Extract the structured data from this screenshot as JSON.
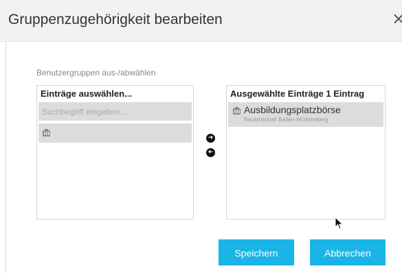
{
  "dialog": {
    "title": "Gruppenzugehörigkeit bearbeiten",
    "close_glyph": "×",
    "icons": {
      "close": "close-icon",
      "group": "group-building-icon",
      "move_right": "arrow-right-circle-icon",
      "move_left": "arrow-left-circle-icon",
      "cursor": "mouse-pointer-icon"
    }
  },
  "section": {
    "label": "Benutzergruppen aus-/abwählen"
  },
  "left_panel": {
    "header": "Einträge auswählen...",
    "search_placeholder": "Suchbegriff eingeben..."
  },
  "right_panel": {
    "header": "Ausgewählte Einträge 1 Eintrag",
    "items": [
      {
        "title": "Ausbildungsplatzbörse",
        "subtitle": "Bauwirtschaft Baden-Württemberg"
      }
    ]
  },
  "buttons": {
    "save": "Speichern",
    "cancel": "Abbrechen"
  },
  "colors": {
    "accent": "#1ab4e6",
    "title_bar": "#f2f2f2",
    "item_background": "#dcdcdc"
  }
}
